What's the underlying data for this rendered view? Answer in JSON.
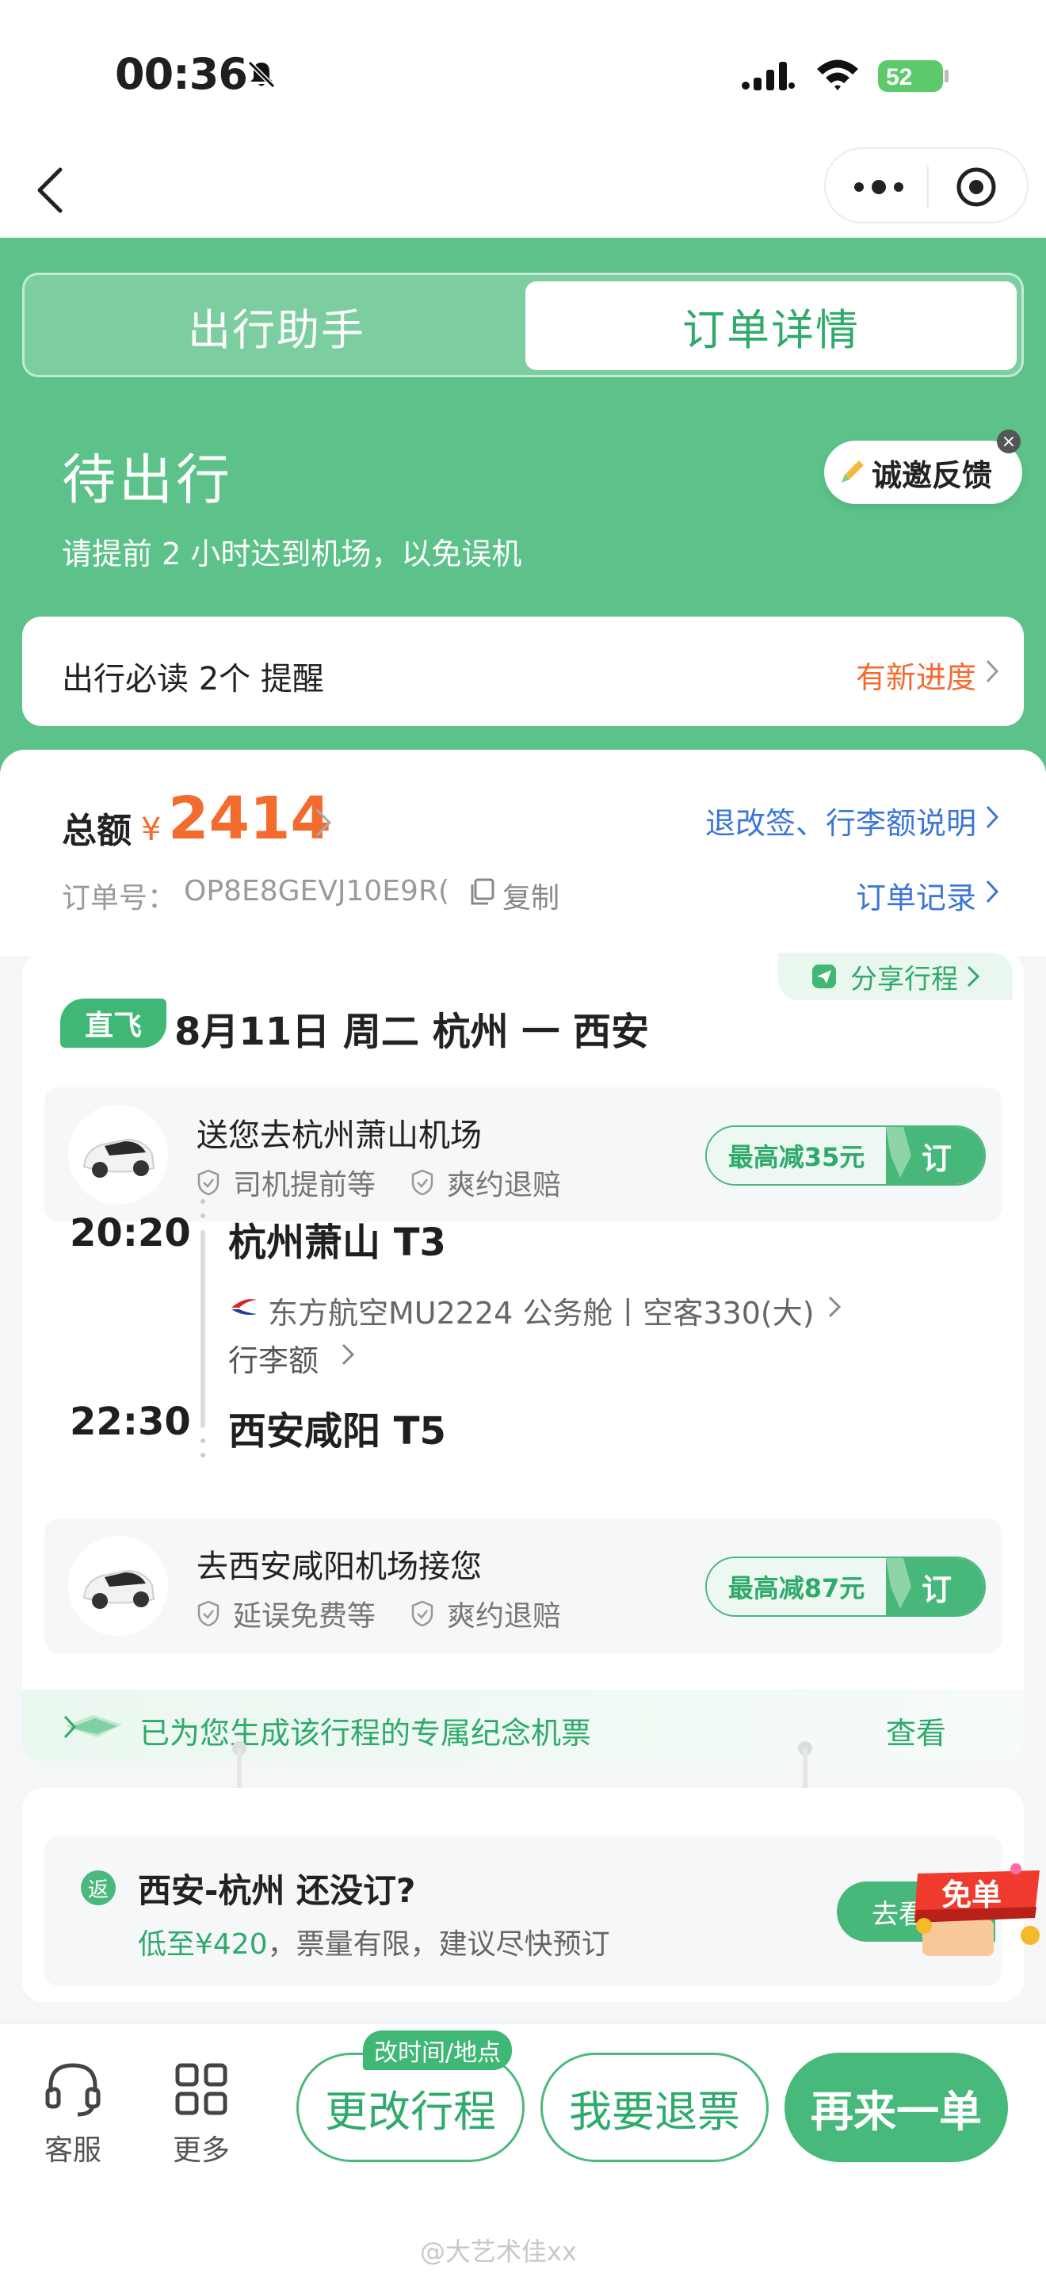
{
  "status_bar": {
    "time": "00:36",
    "battery": "52"
  },
  "tabs": {
    "assistant": "出行助手",
    "order_detail": "订单详情"
  },
  "trip_status": {
    "title": "待出行",
    "subtitle": "请提前 2 小时达到机场，以免误机",
    "feedback_label": "诚邀反馈"
  },
  "reminder": {
    "text": "出行必读 2个 提醒",
    "progress": "有新进度"
  },
  "order": {
    "total_label": "总额",
    "currency": "¥",
    "total_amount": "2414",
    "refund_rules": "退改签、行李额说明",
    "order_no_label": "订单号：",
    "order_no_value": "OP8E8GEVJ10E9R(",
    "copy_label": "复制",
    "records": "订单记录"
  },
  "flight": {
    "share": "分享行程",
    "badge": "直飞",
    "route": "8月11日 周二 杭州 一 西安",
    "departure_time": "20:20",
    "departure_airport": "杭州萧山 T3",
    "arrival_time": "22:30",
    "arrival_airport": "西安咸阳 T5",
    "airline_info": "东方航空MU2224  公务舱丨空客330(大)",
    "baggage": "行李额",
    "memo_text": "已为您生成该行程的专属纪念机票",
    "memo_view": "查看"
  },
  "car_services": [
    {
      "title": "送您去杭州萧山机场",
      "tag1": "司机提前等",
      "tag2": "爽约退赔",
      "discount": "最高减35元",
      "book": "订"
    },
    {
      "title": "去西安咸阳机场接您",
      "tag1": "延误免费等",
      "tag2": "爽约退赔",
      "discount": "最高减87元",
      "book": "订"
    }
  ],
  "return_trip": {
    "badge": "返",
    "title": "西安-杭州 还没订?",
    "price": "低至¥420",
    "note": "，票量有限，建议尽快预订",
    "button": "去看看",
    "free_badge": "免单"
  },
  "bottom_bar": {
    "service": "客服",
    "more": "更多",
    "change_tag": "改时间/地点",
    "change": "更改行程",
    "refund": "我要退票",
    "again": "再来一单",
    "watermark": "@大艺术佳xx"
  },
  "colors": {
    "brand_green": "#5cc289",
    "accent_orange": "#f26b2f",
    "link_blue": "#3b76d8"
  }
}
